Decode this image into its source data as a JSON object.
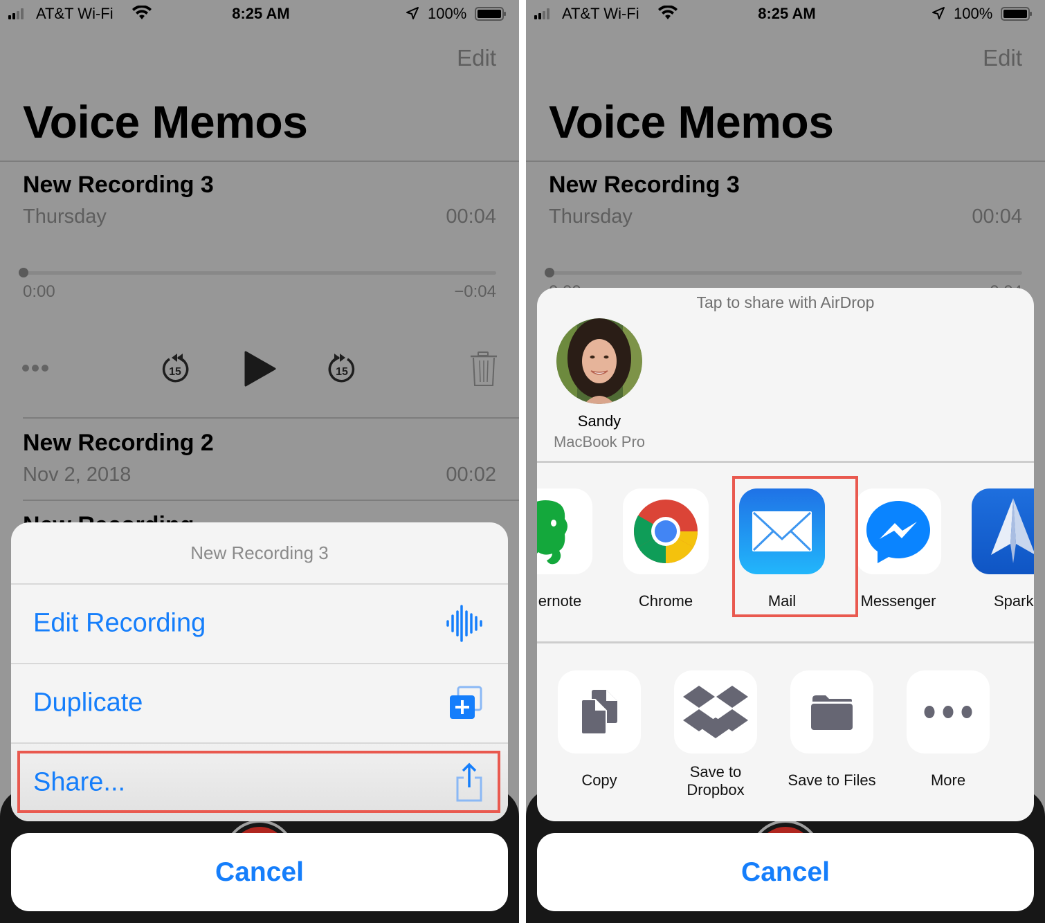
{
  "status_bar": {
    "carrier": "AT&T Wi-Fi",
    "time": "8:25 AM",
    "battery": "100%",
    "signal_bars_active": 2,
    "signal_bars_total": 4
  },
  "nav": {
    "edit_label": "Edit",
    "title": "Voice Memos"
  },
  "recordings": [
    {
      "title": "New Recording 3",
      "date": "Thursday",
      "duration": "00:04"
    },
    {
      "title": "New Recording 2",
      "date": "Nov 2, 2018",
      "duration": "00:02"
    },
    {
      "title": "New Recording",
      "date": "",
      "duration": ""
    }
  ],
  "player": {
    "elapsed": "0:00",
    "remaining": "−0:04",
    "progress_percent": 0,
    "skip_back_seconds": "15",
    "skip_forward_seconds": "15"
  },
  "action_sheet": {
    "title": "New Recording 3",
    "items": [
      {
        "label": "Edit Recording",
        "icon": "waveform-icon"
      },
      {
        "label": "Duplicate",
        "icon": "duplicate-icon"
      },
      {
        "label": "Share...",
        "icon": "share-icon"
      }
    ],
    "cancel_label": "Cancel"
  },
  "share_sheet": {
    "airdrop_caption": "Tap to share with AirDrop",
    "airdrop_people": [
      {
        "name": "Sandy",
        "device": "MacBook Pro"
      }
    ],
    "apps": [
      {
        "label": "Evernote",
        "visible_label": "ernote",
        "icon": "evernote-icon"
      },
      {
        "label": "Chrome",
        "icon": "chrome-icon"
      },
      {
        "label": "Mail",
        "icon": "mail-icon"
      },
      {
        "label": "Messenger",
        "icon": "messenger-icon"
      },
      {
        "label": "Spark",
        "icon": "spark-icon"
      }
    ],
    "actions": [
      {
        "label": "Copy",
        "icon": "copy-icon"
      },
      {
        "label_line1": "Save to",
        "label_line2": "Dropbox",
        "icon": "dropbox-icon"
      },
      {
        "label": "Save to Files",
        "icon": "folder-icon"
      },
      {
        "label": "More",
        "icon": "more-icon"
      }
    ],
    "cancel_label": "Cancel"
  },
  "colors": {
    "ios_blue": "#157efb",
    "highlight_red": "#e9594f",
    "dimmed_background": "#979797",
    "record_red": "#b0261f"
  }
}
